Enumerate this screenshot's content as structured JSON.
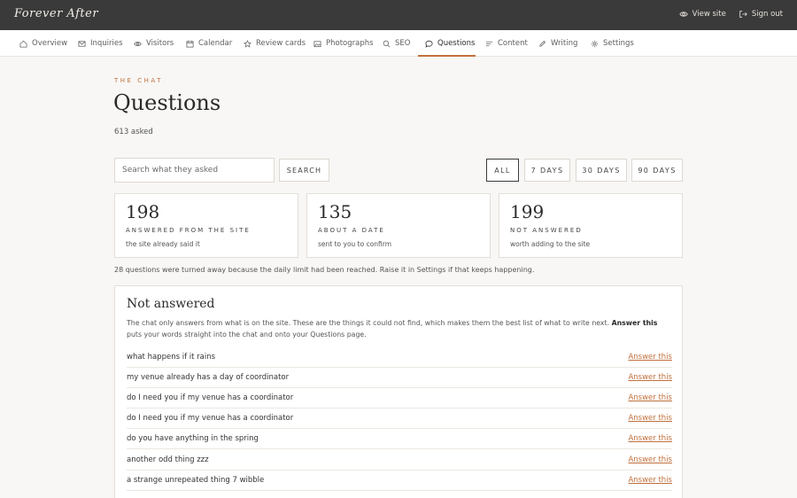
{
  "app": {
    "brand": "Forever After"
  },
  "top_actions": [
    {
      "label": "View site",
      "icon": "eye-icon"
    },
    {
      "label": "Sign out",
      "icon": "sign-out-icon"
    }
  ],
  "nav": [
    {
      "label": "Overview",
      "icon": "home-icon"
    },
    {
      "label": "Inquiries",
      "icon": "mail-icon"
    },
    {
      "label": "Visitors",
      "icon": "eye-icon"
    },
    {
      "label": "Calendar",
      "icon": "calendar-icon"
    },
    {
      "label": "Review cards",
      "icon": "star-icon"
    },
    {
      "label": "Photographs",
      "icon": "image-icon"
    },
    {
      "label": "SEO",
      "icon": "search-icon"
    },
    {
      "label": "Questions",
      "icon": "chat-bubble-icon",
      "active": true
    },
    {
      "label": "Content",
      "icon": "lines-icon"
    },
    {
      "label": "Writing",
      "icon": "pen-icon"
    },
    {
      "label": "Settings",
      "icon": "gear-icon"
    }
  ],
  "header": {
    "eyebrow": "THE CHAT",
    "title": "Questions",
    "count": "613 asked"
  },
  "search": {
    "placeholder": "Search what they asked",
    "button": "SEARCH"
  },
  "filters": [
    {
      "label": "ALL",
      "active": true
    },
    {
      "label": "7 DAYS"
    },
    {
      "label": "30 DAYS"
    },
    {
      "label": "90 DAYS"
    }
  ],
  "stats": [
    {
      "value": "198",
      "label": "ANSWERED FROM THE SITE",
      "sub": "the site already said it"
    },
    {
      "value": "135",
      "label": "ABOUT A DATE",
      "sub": "sent to you to confirm"
    },
    {
      "value": "199",
      "label": "NOT ANSWERED",
      "sub": "worth adding to the site"
    }
  ],
  "notice": "28 questions were turned away because the daily limit had been reached. Raise it in Settings if that keeps happening.",
  "unanswered": {
    "title": "Not answered",
    "desc_before": "The chat only answers from what is on the site. These are the things it could not find, which makes them the best list of what to write next.",
    "desc_bold": "Answer this",
    "desc_after": "puts your words straight into the chat and onto your Questions page.",
    "action_label": "Answer this",
    "items": [
      "what happens if it rains",
      "my venue already has a day of coordinator",
      "do I need you if my venue has a coordinator",
      "do I need you if my venue has a coordinator",
      "do you have anything in the spring",
      "another odd thing zzz",
      "a strange unrepeated thing 7 wibble"
    ]
  },
  "colors": {
    "accent": "#c0703d",
    "topbar": "#3a3a3a",
    "background": "#f8f7f5"
  }
}
